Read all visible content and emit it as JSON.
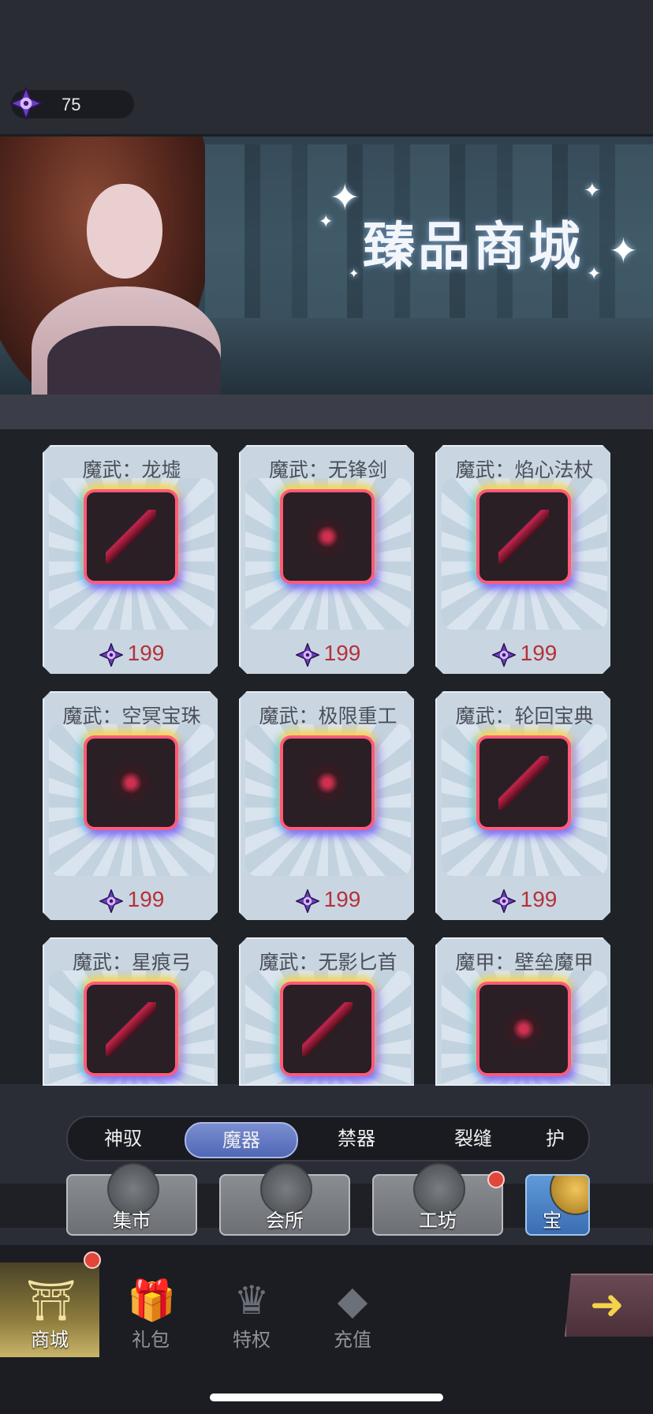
{
  "currency": {
    "value": "75",
    "icon": "purple-gem-icon"
  },
  "banner": {
    "title": "臻品商城"
  },
  "items": [
    {
      "name": "魔武：龙墟",
      "price": "199"
    },
    {
      "name": "魔武：无锋剑",
      "price": "199"
    },
    {
      "name": "魔武：焰心法杖",
      "price": "199"
    },
    {
      "name": "魔武：空冥宝珠",
      "price": "199"
    },
    {
      "name": "魔武：极限重工",
      "price": "199"
    },
    {
      "name": "魔武：轮回宝典",
      "price": "199"
    },
    {
      "name": "魔武：星痕弓",
      "price": ""
    },
    {
      "name": "魔武：无影匕首",
      "price": ""
    },
    {
      "name": "魔甲：壁垒魔甲",
      "price": ""
    }
  ],
  "category_tabs": [
    "神驭",
    "魔器",
    "禁器",
    "裂缝",
    "护"
  ],
  "active_category": "魔器",
  "sub_buttons": [
    "集市",
    "会所",
    "工坊",
    "宝"
  ],
  "nav": [
    "商城",
    "礼包",
    "特权",
    "充值"
  ],
  "colors": {
    "price_red": "#b5323a",
    "accent_blue": "#5067b6",
    "badge_red": "#e2463b"
  }
}
